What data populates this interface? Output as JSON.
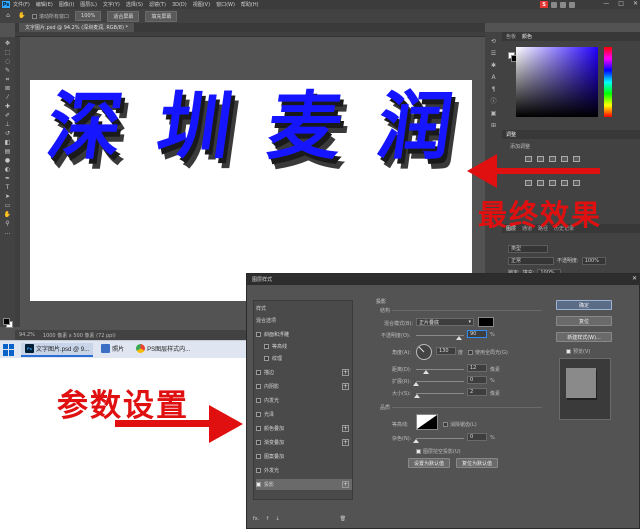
{
  "photoshop": {
    "logo": "Ps",
    "menu": [
      "文件(F)",
      "编辑(E)",
      "图像(I)",
      "图层(L)",
      "文字(Y)",
      "选择(S)",
      "滤镜(T)",
      "3D(D)",
      "视图(V)",
      "窗口(W)",
      "帮助(H)"
    ],
    "tray_s_label": "S",
    "window_buttons": [
      "—",
      "□",
      "✕"
    ],
    "options_bar": {
      "scroll_all_label": "滚动所有窗口",
      "zoom_value": "100%",
      "fit_screen_label": "适合屏幕",
      "fill_screen_label": "填充屏幕"
    },
    "doc_tab": "文字图片.psd @ 94.2% (深圳麦润, RGB/8) *",
    "canvas_chars": [
      "深",
      "圳",
      "麦",
      "润"
    ],
    "status": {
      "zoom": "94.2%",
      "doc_size": "1000 像素 x 500 像素 (72 ppi)"
    },
    "color_panel": {
      "tabs": [
        "色板",
        "颜色"
      ]
    },
    "adjust_panel": {
      "tab": "调整",
      "add_label": "添加调整"
    },
    "layers_panel": {
      "tabs": [
        "图层",
        "通道",
        "路径",
        "历史记录"
      ],
      "kind_label": "类型",
      "blend_mode": "正常",
      "opacity_label": "不透明度:",
      "opacity_value": "100%",
      "lock_label": "锁定:",
      "fill_label": "填充:",
      "fill_value": "100%"
    }
  },
  "taskbar": {
    "items": [
      {
        "label": "文字图片.psd @ 9...",
        "icon": "Ps"
      },
      {
        "label": "照片",
        "icon": ""
      },
      {
        "label": "PS图层样式内...",
        "icon": ""
      }
    ]
  },
  "annotations": {
    "final_effect": "最终效果",
    "param_settings": "参数设置"
  },
  "layer_style_dialog": {
    "title": "图层样式",
    "close": "✕",
    "styles_header": "样式",
    "blend_options": "混合选项",
    "style_items": [
      {
        "label": "斜面和浮雕",
        "checked": false,
        "plus": false,
        "indent": false
      },
      {
        "label": "等高线",
        "checked": false,
        "plus": false,
        "indent": true
      },
      {
        "label": "纹理",
        "checked": false,
        "plus": false,
        "indent": true
      },
      {
        "label": "描边",
        "checked": false,
        "plus": true,
        "indent": false
      },
      {
        "label": "内阴影",
        "checked": false,
        "plus": true,
        "indent": false
      },
      {
        "label": "内发光",
        "checked": false,
        "plus": false,
        "indent": false
      },
      {
        "label": "光泽",
        "checked": false,
        "plus": false,
        "indent": false
      },
      {
        "label": "颜色叠加",
        "checked": false,
        "plus": true,
        "indent": false
      },
      {
        "label": "渐变叠加",
        "checked": false,
        "plus": true,
        "indent": false
      },
      {
        "label": "图案叠加",
        "checked": false,
        "plus": false,
        "indent": false
      },
      {
        "label": "外发光",
        "checked": false,
        "plus": false,
        "indent": false
      },
      {
        "label": "投影",
        "checked": true,
        "plus": true,
        "indent": false
      }
    ],
    "bottom_icons": [
      "fx.",
      "↑",
      "↓",
      "🗑"
    ],
    "section_title": "投影",
    "structure": {
      "heading": "结构",
      "blend_mode_label": "混合模式(B):",
      "blend_mode_value": "正片叠底",
      "opacity_label": "不透明度(O):",
      "opacity_value": "90",
      "opacity_level": 0.9,
      "percent": "%",
      "angle_label": "角度(A):",
      "angle_value": "130",
      "angle_unit": "度",
      "global_light_label": "使用全局光(G)",
      "distance_label": "距离(D):",
      "distance_value": "12",
      "distance_unit": "像素",
      "spread_label": "扩展(R):",
      "spread_value": "0",
      "size_label": "大小(S):",
      "size_value": "2",
      "size_unit": "像素"
    },
    "quality": {
      "heading": "品质",
      "contour_label": "等高线:",
      "antialias_label": "消除锯齿(L)",
      "noise_label": "杂色(N):",
      "noise_value": "0",
      "knockout_label": "图层挖空投影(U)",
      "make_default": "设置为默认值",
      "reset_default": "复位为默认值"
    },
    "buttons": {
      "ok": "确定",
      "reset": "复位",
      "new_style": "新建样式(W)...",
      "preview": "预览(V)"
    }
  }
}
